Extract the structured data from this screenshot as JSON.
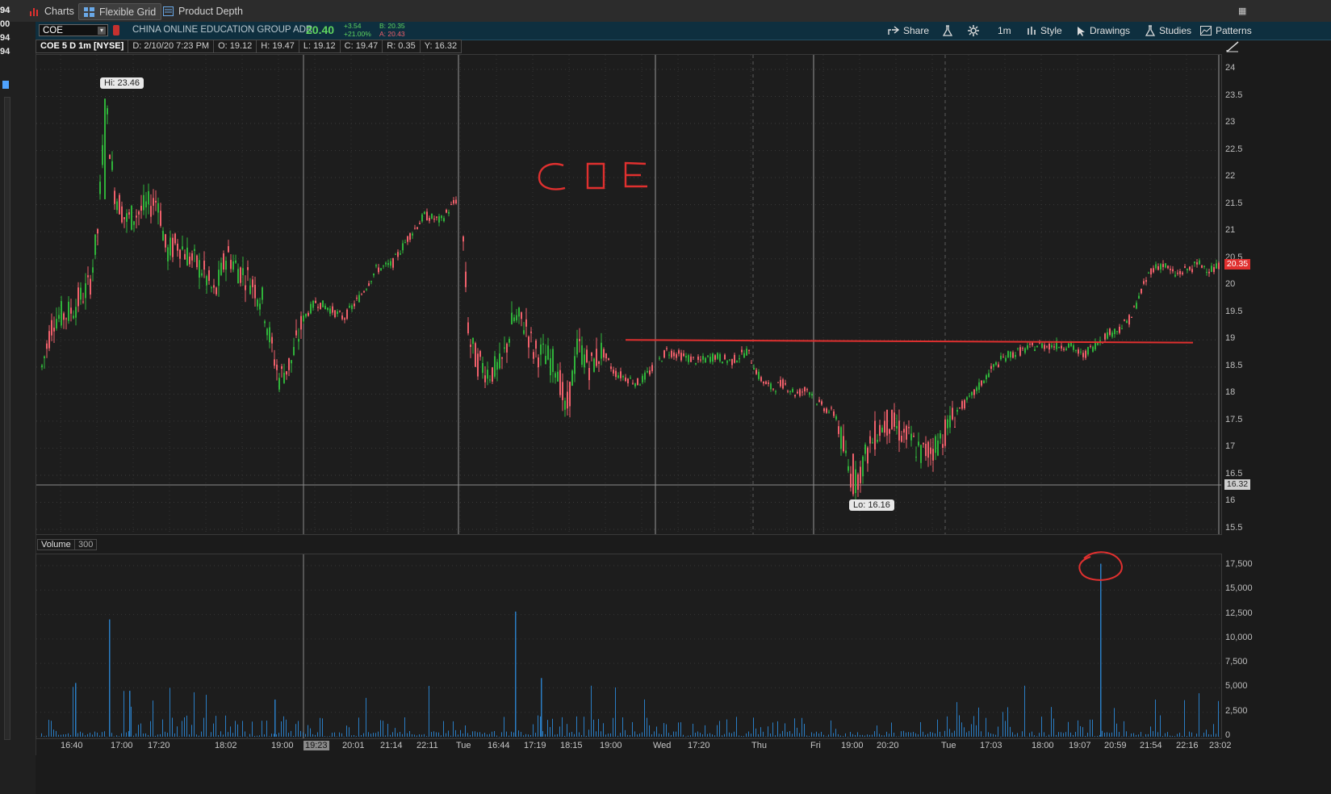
{
  "tabs": [
    {
      "label": "Charts",
      "icon": "bar-chart-icon",
      "active": false
    },
    {
      "label": "Flexible Grid",
      "icon": "grid-icon",
      "active": true
    },
    {
      "label": "Product Depth",
      "icon": "depth-icon",
      "active": false
    }
  ],
  "left_strip_values": [
    "94",
    "00",
    "94",
    "94"
  ],
  "symbol": {
    "ticker": "COE",
    "company_name": "CHINA ONLINE EDUCATION GROUP ADR",
    "last_price": "20.40",
    "change": "+3.54",
    "change_pct": "+21.00%",
    "bid": "B: 20.35",
    "ask": "A: 20.43"
  },
  "toolbar": {
    "share": "Share",
    "timeframe": "1m",
    "style": "Style",
    "drawings": "Drawings",
    "studies": "Studies",
    "patterns": "Patterns"
  },
  "info_bar": {
    "title": "COE 5 D 1m [NYSE]",
    "date": "D: 2/10/20 7:23 PM",
    "open": "O: 19.12",
    "high": "H: 19.47",
    "low": "L: 19.12",
    "close": "C: 19.47",
    "range": "R: 0.35",
    "y": "Y: 16.32"
  },
  "price_axis": {
    "ticks": [
      "24",
      "23.5",
      "23",
      "22.5",
      "22",
      "21.5",
      "21",
      "20.5",
      "20",
      "19.5",
      "19",
      "18.5",
      "18",
      "17.5",
      "17",
      "16.5",
      "16",
      "15.5"
    ],
    "current_price_label": "20.35",
    "crosshair_label": "16.32"
  },
  "annotations": {
    "hi_label": "Hi: 23.46",
    "lo_label": "Lo: 16.16",
    "handwritten_text": "COE",
    "horizontal_line_price": 19.0,
    "colors": {
      "drawing": "#e0302f",
      "up_candle": "#2fb33a",
      "down_candle": "#f0606b",
      "volume": "#2a7dc4",
      "header_bg": "#0e2f3f"
    }
  },
  "volume": {
    "label": "Volume",
    "sub_label": "300",
    "axis_ticks": [
      "17,500",
      "15,000",
      "12,500",
      "10,000",
      "7,500",
      "5,000",
      "2,500",
      "0"
    ]
  },
  "x_axis": {
    "labels": [
      "16:40",
      "17:00",
      "17:20",
      "18:02",
      "19:00",
      "19:23",
      "20:01",
      "21:14",
      "22:11",
      "Tue",
      "16:44",
      "17:19",
      "18:15",
      "19:00",
      "Wed",
      "17:20",
      "Thu",
      "Fri",
      "19:00",
      "20:20",
      "Tue",
      "17:03",
      "18:00",
      "19:07",
      "20:59",
      "21:54",
      "22:16",
      "23:02"
    ],
    "highlighted": "19:23"
  }
}
